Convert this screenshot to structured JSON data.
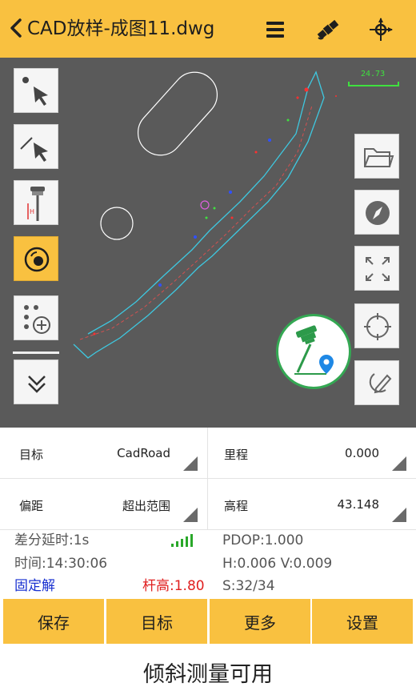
{
  "header": {
    "back_icon": "chevron-left-icon",
    "title": "CAD放样-成图11.dwg",
    "icons": [
      "list-icon",
      "satellite-icon",
      "crosshair-icon"
    ]
  },
  "map": {
    "scale_label": "24.73",
    "tools_left": [
      {
        "name": "select-point-icon"
      },
      {
        "name": "select-line-icon"
      },
      {
        "name": "rover-pole-icon"
      },
      {
        "name": "target-lock-icon",
        "active": true
      },
      {
        "name": "add-points-icon"
      },
      {
        "name": "expand-down-icon"
      }
    ],
    "tools_right": [
      {
        "name": "folder-icon"
      },
      {
        "name": "compass-icon"
      },
      {
        "name": "fullscreen-icon"
      },
      {
        "name": "locate-icon"
      },
      {
        "name": "draw-icon"
      }
    ],
    "gnss_icon": "gnss-receiver-icon"
  },
  "info": {
    "target_label": "目标",
    "target_value": "CadRoad",
    "mileage_label": "里程",
    "mileage_value": "0.000",
    "offset_label": "偏距",
    "offset_value": "超出范围",
    "elevation_label": "高程",
    "elevation_value": "43.148"
  },
  "status": {
    "diff_delay": "差分延时:1s",
    "time": "时间:14:30:06",
    "solution": "固定解",
    "pole_height": "杆高:1.80",
    "pdop": "PDOP:1.000",
    "hv": "H:0.006  V:0.009",
    "sats": "S:32/34"
  },
  "buttons": {
    "save": "保存",
    "target": "目标",
    "more": "更多",
    "settings": "设置"
  },
  "footer": "倾斜测量可用",
  "colors": {
    "accent": "#f9c140",
    "map_bg": "#5a5a5a",
    "road_line": "#3ec8e0",
    "fixed_solution": "#1830d0",
    "pole_height": "#e01f1f"
  }
}
